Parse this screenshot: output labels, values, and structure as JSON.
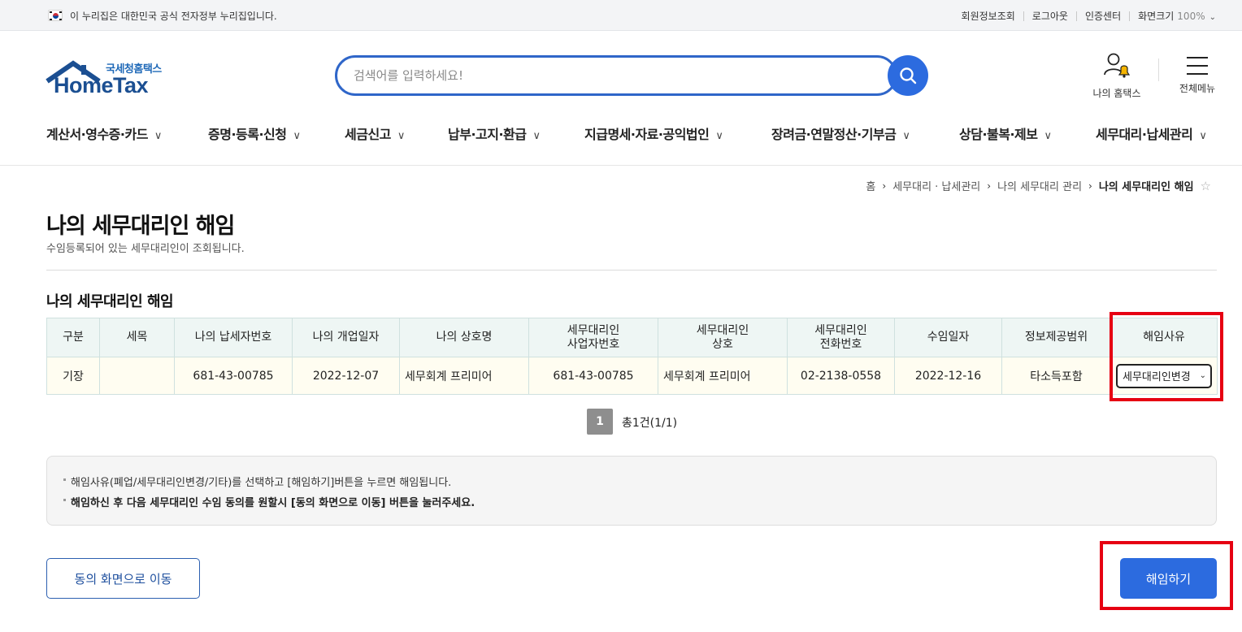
{
  "topbar": {
    "gov_notice": "이 누리집은 대한민국 공식 전자정부 누리집입니다.",
    "links": [
      "회원정보조회",
      "로그아웃",
      "인증센터"
    ],
    "zoom_label": "화면크기",
    "zoom_value": "100%"
  },
  "logo": {
    "kr": "국세청홈택스",
    "en": "HomeTax"
  },
  "search": {
    "placeholder": "검색어를 입력하세요!"
  },
  "header": {
    "my_home": "나의 홈택스",
    "all_menu": "전체메뉴"
  },
  "gnb": [
    "계산서·영수증·카드",
    "증명·등록·신청",
    "세금신고",
    "납부·고지·환급",
    "지급명세·자료·공익법인",
    "장려금·연말정산·기부금",
    "상담·불복·제보",
    "세무대리·납세관리"
  ],
  "breadcrumb": [
    "홈",
    "세무대리 · 납세관리",
    "나의 세무대리 관리",
    "나의 세무대리인 해임"
  ],
  "page": {
    "title": "나의 세무대리인 해임",
    "subtitle": "수임등록되어 있는 세무대리인이 조회됩니다.",
    "section_title": "나의 세무대리인 해임"
  },
  "table": {
    "headers": [
      [
        "구분"
      ],
      [
        "세목"
      ],
      [
        "나의 납세자번호"
      ],
      [
        "나의 개업일자"
      ],
      [
        "나의 상호명"
      ],
      [
        "세무대리인",
        "사업자번호"
      ],
      [
        "세무대리인",
        "상호"
      ],
      [
        "세무대리인",
        "전화번호"
      ],
      [
        "수임일자"
      ],
      [
        "정보제공범위"
      ],
      [
        "해임사유"
      ]
    ],
    "rows": [
      {
        "type": "기장",
        "tax_item": "",
        "my_taxpayer_no": "681-43-00785",
        "my_open_date": "2022-12-07",
        "my_trade_name": "세무회계 프리미어",
        "agent_biz_no": "681-43-00785",
        "agent_trade_name": "세무회계 프리미어",
        "agent_phone": "02-2138-0558",
        "engagement_date": "2022-12-16",
        "info_scope": "타소득포함",
        "dismiss_reason": "세무대리인변경"
      }
    ]
  },
  "pagination": {
    "current": "1",
    "total_text": "총1건(1/1)"
  },
  "notice": {
    "line1": "해임사유(폐업/세무대리인변경/기타)를 선택하고 [해임하기]버튼을 누르면 해임됩니다.",
    "line2": "해임하신 후 다음 세무대리인 수임 동의를 원할시 [동의 화면으로 이동] 버튼을 눌러주세요."
  },
  "buttons": {
    "consent": "동의 화면으로 이동",
    "dismiss": "해임하기"
  },
  "colors": {
    "primary": "#2c6bdf",
    "highlight": "#e60012",
    "header_cell": "#eef6f4",
    "data_cell": "#fffdf1"
  }
}
